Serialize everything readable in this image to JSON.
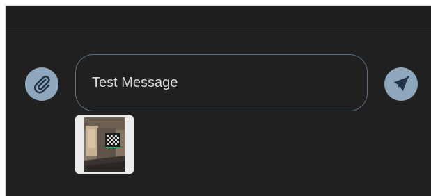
{
  "composer": {
    "message_value": "Test Message",
    "attach_icon": "paperclip-icon",
    "send_icon": "send-icon"
  },
  "attachments": [
    {
      "type": "image",
      "description_icon": "image-thumbnail"
    }
  ],
  "colors": {
    "background": "#202020",
    "button_fill": "#8fa7bd",
    "input_border": "#5a7086",
    "icon_dark": "#243447"
  }
}
